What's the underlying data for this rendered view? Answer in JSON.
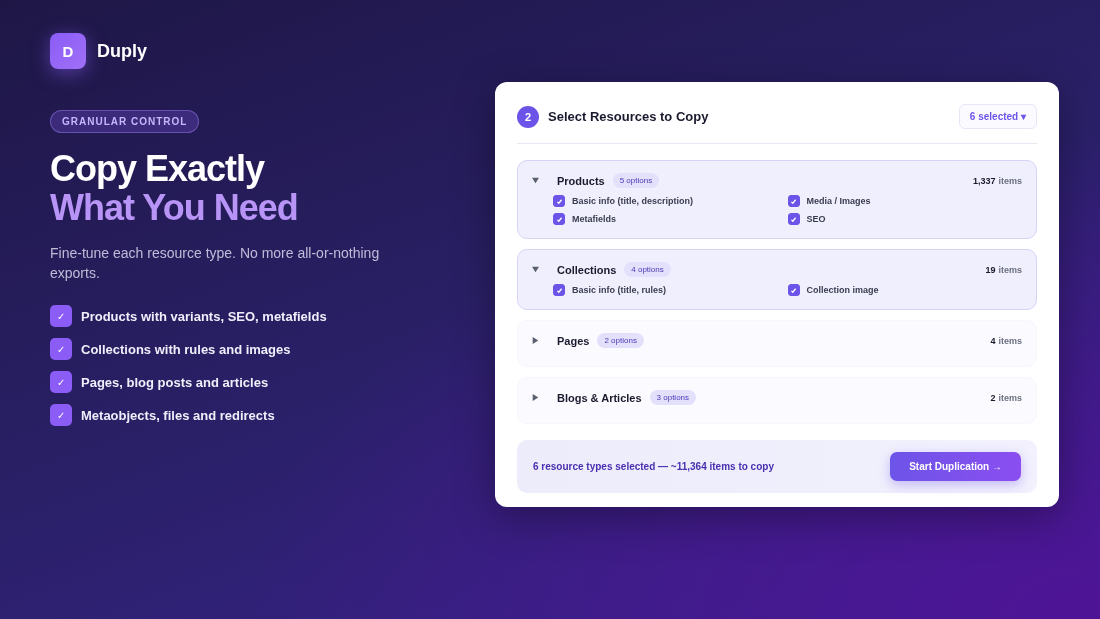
{
  "brand": {
    "logo_letter": "D",
    "name": "Duply"
  },
  "hero": {
    "badge": "GRANULAR CONTROL",
    "title_line_1": "Copy Exactly",
    "title_line_2": "What You Need",
    "subtitle": "Fine-tune each resource type. No more all-or-nothing exports.",
    "features": [
      {
        "mark": "✓",
        "label": "Products with variants, SEO, metafields"
      },
      {
        "mark": "✓",
        "label": "Collections with rules and images"
      },
      {
        "mark": "✓",
        "label": "Pages, blog posts and articles"
      },
      {
        "mark": "✓",
        "label": "Metaobjects, files and redirects"
      }
    ]
  },
  "panel": {
    "step": "2",
    "title": "Select Resources to Copy",
    "selection_button": "6 selected ▾",
    "resources": [
      {
        "name": "Products",
        "badge": "5 options",
        "count": "1,337",
        "unit": "items",
        "expanded": true,
        "options": [
          {
            "label": "Basic info (title, description)",
            "checked": true
          },
          {
            "label": "Media / Images",
            "checked": true
          },
          {
            "label": "Metafields",
            "checked": true
          },
          {
            "label": "SEO",
            "checked": true
          }
        ]
      },
      {
        "name": "Collections",
        "badge": "4 options",
        "count": "19",
        "unit": "items",
        "expanded": true,
        "options": [
          {
            "label": "Basic info (title, rules)",
            "checked": true
          },
          {
            "label": "Collection image",
            "checked": true
          }
        ]
      },
      {
        "name": "Pages",
        "badge": "2 options",
        "count": "4",
        "unit": "items",
        "expanded": false
      },
      {
        "name": "Blogs & Articles",
        "badge": "3 options",
        "count": "2",
        "unit": "items",
        "expanded": false
      }
    ],
    "summary": "6 resource types selected — ~11,364 items to copy",
    "action": "Start Duplication →"
  }
}
